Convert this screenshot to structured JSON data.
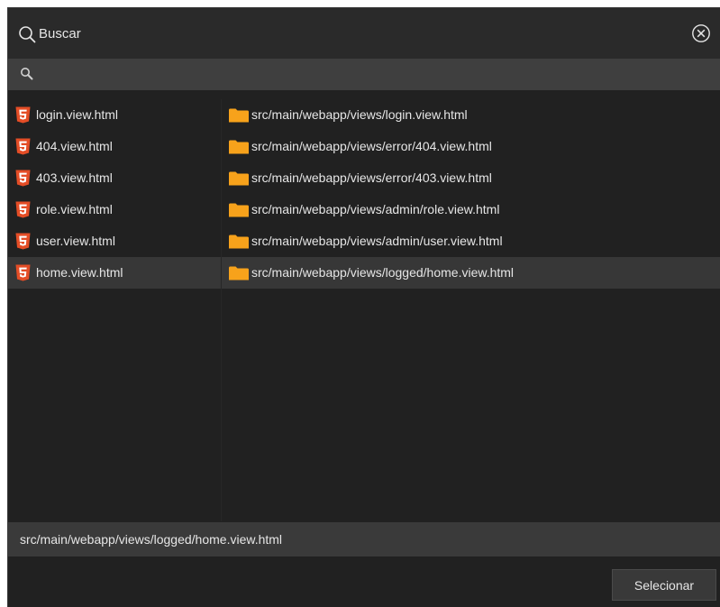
{
  "dialog": {
    "title": "Buscar",
    "filter": {
      "value": "",
      "placeholder": ""
    },
    "results": [
      {
        "name": "login.view.html",
        "path": "src/main/webapp/views/login.view.html",
        "selected": false
      },
      {
        "name": "404.view.html",
        "path": "src/main/webapp/views/error/404.view.html",
        "selected": false
      },
      {
        "name": "403.view.html",
        "path": "src/main/webapp/views/error/403.view.html",
        "selected": false
      },
      {
        "name": "role.view.html",
        "path": "src/main/webapp/views/admin/role.view.html",
        "selected": false
      },
      {
        "name": "user.view.html",
        "path": "src/main/webapp/views/admin/user.view.html",
        "selected": false
      },
      {
        "name": "home.view.html",
        "path": "src/main/webapp/views/logged/home.view.html",
        "selected": true
      }
    ],
    "selected_path": "src/main/webapp/views/logged/home.view.html",
    "select_button_label": "Selecionar"
  },
  "icons": {
    "title": "search-icon",
    "close": "close-circle-icon",
    "filter": "search-icon",
    "file": "html5-icon",
    "folder": "folder-icon"
  },
  "colors": {
    "html5": "#e44d26",
    "folder": "#f7a21b",
    "selected_row": "#373737"
  }
}
